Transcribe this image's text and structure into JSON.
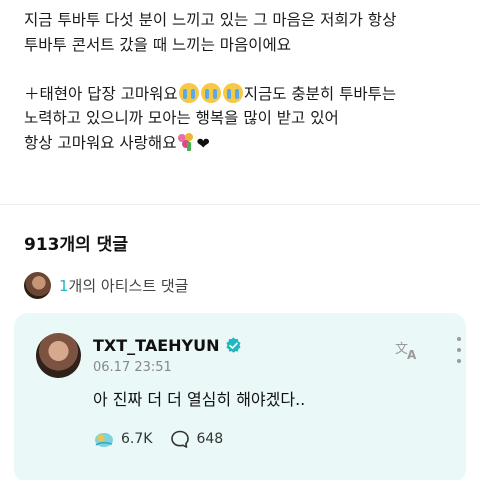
{
  "post": {
    "line1": "지금 투바투 다섯 분이 느끼고 있는 그 마음은 저희가 항상",
    "line2": "투바투 콘서트 갔을 때 느끼는 마음이에요",
    "line3_prefix": "＋태현아 답장 고마워요",
    "line3_suffix": "지금도 충분히 투바투는",
    "line4": "노력하고 있으니까 모아는 행복을 많이 받고 있어",
    "line5": "항상 고마워요 사랑해요"
  },
  "comments": {
    "count_label": "913개의 댓글",
    "artist_count": "1",
    "artist_label_suffix": "개의 아티스트 댓글"
  },
  "reply": {
    "author": "TXT_TAEHYUN",
    "timestamp": "06.17 23:51",
    "text": "아 진짜 더 더 열심히 해야겠다..",
    "likes": "6.7K",
    "replies": "648"
  },
  "icons": {
    "verified": "verified-badge-icon",
    "translate": "translate-icon",
    "more": "more-vertical-icon",
    "like": "like-icon",
    "reply": "comment-bubble-icon",
    "crying": "loudly-crying-face-emoji",
    "bouquet": "bouquet-emoji",
    "heart": "black-heart-emoji"
  },
  "colors": {
    "accent": "#1fb7c0",
    "card_bg": "#eaf8f8",
    "muted": "#888888"
  }
}
